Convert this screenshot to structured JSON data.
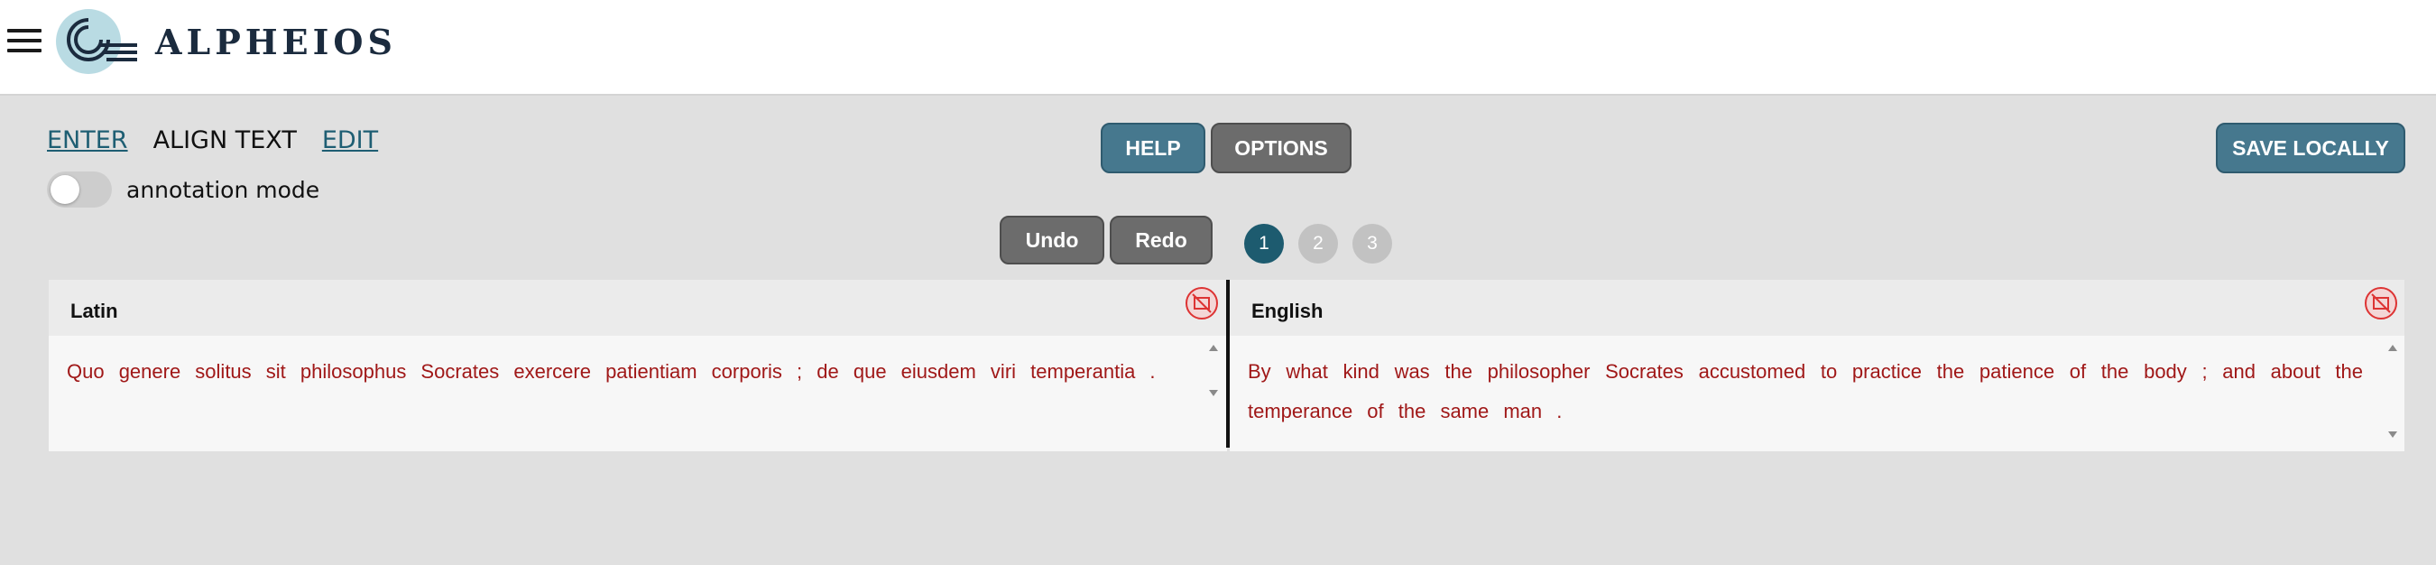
{
  "app": {
    "logo_text": "ALPHEIOS"
  },
  "nav": {
    "enter": "ENTER",
    "align": "ALIGN TEXT",
    "edit": "EDIT"
  },
  "annotation_label": "annotation mode",
  "buttons": {
    "help": "HELP",
    "options": "OPTIONS",
    "save": "SAVE LOCALLY",
    "undo": "Undo",
    "redo": "Redo"
  },
  "steps": [
    "1",
    "2",
    "3"
  ],
  "panels": {
    "origin": {
      "title": "Latin",
      "text": "Quo genere solitus sit philosophus Socrates exercere patientiam corporis ; de que eiusdem viri temperantia ."
    },
    "target": {
      "title": "English",
      "text": "By what kind was the philosopher Socrates accustomed to practice the patience of the body ; and about the temperance of the same man ."
    }
  },
  "colors": {
    "accent": "#1d5b6f",
    "button_blue": "#46788e",
    "button_gray": "#6c6c6c",
    "token_text": "#a01818"
  }
}
